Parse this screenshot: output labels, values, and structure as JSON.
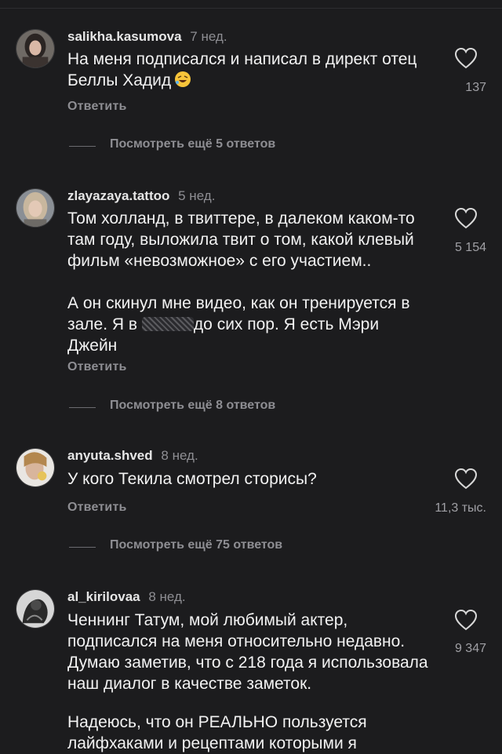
{
  "comments": [
    {
      "username": "salikha.kasumova",
      "time": "7 нед.",
      "paragraphs": [
        "На меня подписался и написал в директ отец Беллы Хадид"
      ],
      "reply_label": "Ответить",
      "likes": "137",
      "more_replies": "Посмотреть ещё 5 ответов",
      "emoji_icon": "rofl-emoji-icon"
    },
    {
      "username": "zlayazaya.tattoo",
      "time": "5 нед.",
      "paragraphs": [
        "Том холланд, в твиттере, в далеком каком-то там году, выложила твит о том, какой клевый фильм «невозможное» с его участием..",
        "А он скинул мне видео, как он тренируется в зале. Я в",
        "до сих пор. Я есть Мэри Джейн"
      ],
      "reply_label": "Ответить",
      "likes": "5 154",
      "more_replies": "Посмотреть ещё 8 ответов"
    },
    {
      "username": "anyuta.shved",
      "time": "8 нед.",
      "paragraphs": [
        "У кого Текила смотрел сторисы?"
      ],
      "reply_label": "Ответить",
      "likes": "11,3 тыс.",
      "more_replies": "Посмотреть ещё 75 ответов"
    },
    {
      "username": "al_kirilovaa",
      "time": "8 нед.",
      "paragraphs": [
        "Ченнинг Татум, мой любимый актер, подписался на меня относительно недавно. Думаю заметив, что с 218 года я использовала наш диалог в качестве заметок.",
        "Надеюсь, что он РЕАЛЬНО пользуется лайфхаками и рецептами которыми я"
      ],
      "likes": "9 347"
    }
  ],
  "colors": {
    "background": "#1c1c1e",
    "text": "#f2f2f2",
    "muted": "#8e8e93"
  },
  "icons": {
    "like": "heart-outline-icon"
  }
}
